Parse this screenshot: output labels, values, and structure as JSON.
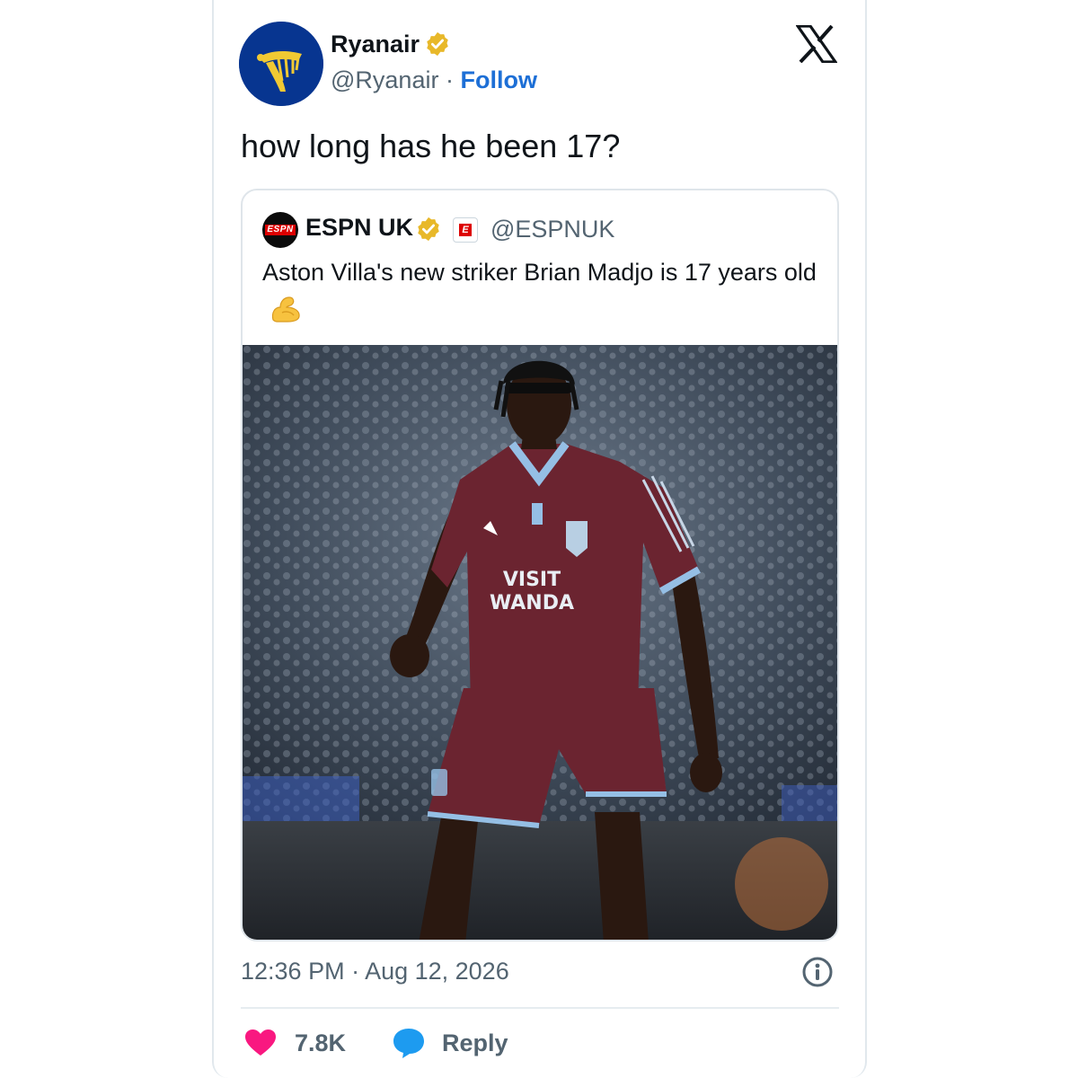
{
  "author": {
    "name": "Ryanair",
    "handle": "@Ryanair",
    "separator": "·",
    "follow_label": "Follow"
  },
  "tweet": {
    "text": "how long has he been 17?",
    "timestamp": "12:36 PM · Aug 12, 2026"
  },
  "quoted": {
    "name": "ESPN UK",
    "handle": "@ESPNUK",
    "text": "Aston Villa's new striker Brian Madjo is 17 years old",
    "emoji": "flexed-biceps",
    "image": {
      "shirt_sponsor_line1": "VISIT",
      "shirt_sponsor_line2": "WANDA"
    }
  },
  "actions": {
    "like_count": "7.8K",
    "reply_label": "Reply"
  },
  "icons": [
    "ryanair-harp-logo",
    "verified-badge-gold",
    "x-logo",
    "espn-logo",
    "espn-affiliate-badge",
    "info-icon",
    "heart-icon",
    "reply-bubble-icon"
  ],
  "colors": {
    "follow_blue": "#1d6fd6",
    "ryanair_navy": "#073590",
    "ryanair_gold": "#f1c933",
    "verified_gold": "#e8b829",
    "heart_pink": "#f91880",
    "reply_blue": "#1d9bf0",
    "muted_text": "#536471",
    "villa_claret": "#6b2430",
    "villa_blue": "#95bfe5"
  }
}
